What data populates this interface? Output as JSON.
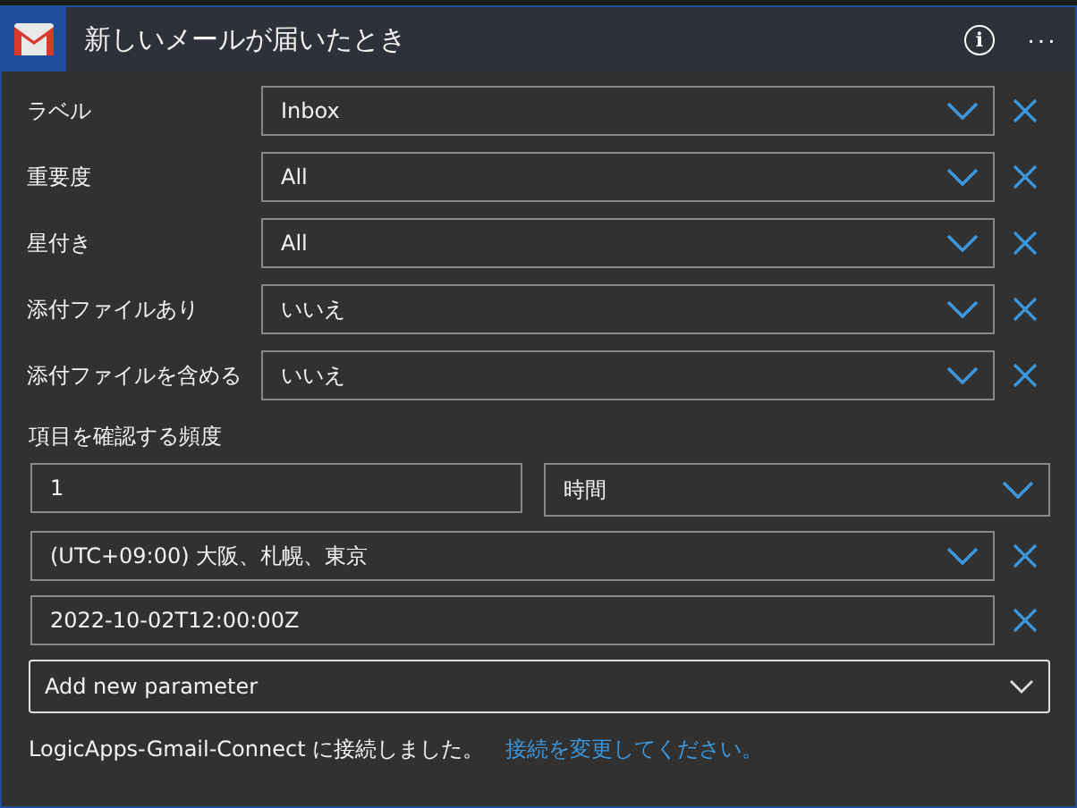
{
  "header": {
    "title": "新しいメールが届いたとき",
    "info_icon": "i",
    "more": "···"
  },
  "params": [
    {
      "label": "ラベル",
      "value": "Inbox"
    },
    {
      "label": "重要度",
      "value": "All"
    },
    {
      "label": "星付き",
      "value": "All"
    },
    {
      "label": "添付ファイルあり",
      "value": "いいえ"
    },
    {
      "label": "添付ファイルを含める",
      "value": "いいえ"
    }
  ],
  "frequency": {
    "label": "項目を確認する頻度",
    "interval": "1",
    "unit": "時間"
  },
  "timezone": {
    "value": "(UTC+09:00) 大阪、札幌、東京"
  },
  "start_time": {
    "value": "2022-10-02T12:00:00Z"
  },
  "add_parameter": {
    "label": "Add new parameter"
  },
  "footer": {
    "text": "LogicApps-Gmail-Connect に接続しました。",
    "link": "接続を変更してください。"
  }
}
